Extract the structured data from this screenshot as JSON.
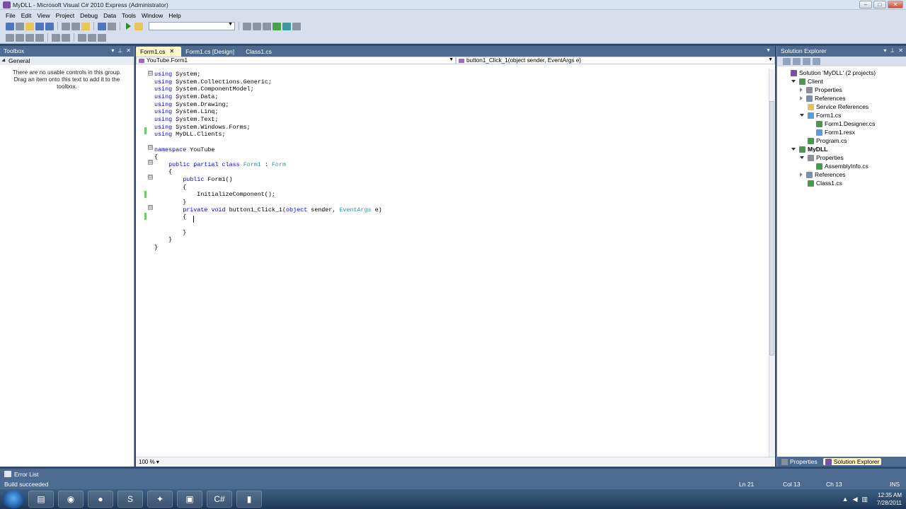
{
  "window": {
    "title": "MyDLL - Microsoft Visual C# 2010 Express (Administrator)",
    "controls": [
      "–",
      "□",
      "✕"
    ]
  },
  "menu": [
    "File",
    "Edit",
    "View",
    "Project",
    "Debug",
    "Data",
    "Tools",
    "Window",
    "Help"
  ],
  "toolbox": {
    "title": "Toolbox",
    "group": "General",
    "message": "There are no usable controls in this group. Drag an item onto this text to add it to the toolbox."
  },
  "tabs": [
    {
      "label": "Form1.cs",
      "active": true,
      "close": "✕"
    },
    {
      "label": "Form1.cs [Design]",
      "active": false
    },
    {
      "label": "Class1.cs",
      "active": false
    }
  ],
  "navbar": {
    "type_combo": "YouTube.Form1",
    "member_combo": "button1_Click_1(object sender, EventArgs e)"
  },
  "code": [
    [
      {
        "t": "using",
        "c": "kw"
      },
      {
        "t": " System;"
      }
    ],
    [
      {
        "t": "using",
        "c": "kw"
      },
      {
        "t": " System.Collections.Generic;"
      }
    ],
    [
      {
        "t": "using",
        "c": "kw"
      },
      {
        "t": " System.ComponentModel;"
      }
    ],
    [
      {
        "t": "using",
        "c": "kw"
      },
      {
        "t": " System.Data;"
      }
    ],
    [
      {
        "t": "using",
        "c": "kw"
      },
      {
        "t": " System.Drawing;"
      }
    ],
    [
      {
        "t": "using",
        "c": "kw"
      },
      {
        "t": " System.Linq;"
      }
    ],
    [
      {
        "t": "using",
        "c": "kw"
      },
      {
        "t": " System.Text;"
      }
    ],
    [
      {
        "t": "using",
        "c": "kw"
      },
      {
        "t": " System.Windows.Forms;"
      }
    ],
    [
      {
        "t": "using",
        "c": "kw"
      },
      {
        "t": " MyDLL.Clients;"
      }
    ],
    [],
    [
      {
        "t": "namespace",
        "c": "kw"
      },
      {
        "t": " YouTube"
      }
    ],
    [
      {
        "t": "{"
      }
    ],
    [
      {
        "t": "    "
      },
      {
        "t": "public",
        "c": "kw"
      },
      {
        "t": " "
      },
      {
        "t": "partial",
        "c": "kw"
      },
      {
        "t": " "
      },
      {
        "t": "class",
        "c": "kw"
      },
      {
        "t": " "
      },
      {
        "t": "Form1",
        "c": "ty"
      },
      {
        "t": " : "
      },
      {
        "t": "Form",
        "c": "ty"
      }
    ],
    [
      {
        "t": "    {"
      }
    ],
    [
      {
        "t": "        "
      },
      {
        "t": "public",
        "c": "kw"
      },
      {
        "t": " Form1()"
      }
    ],
    [
      {
        "t": "        {"
      }
    ],
    [
      {
        "t": "            InitializeComponent();"
      }
    ],
    [
      {
        "t": "        }"
      }
    ],
    [
      {
        "t": "        "
      },
      {
        "t": "private",
        "c": "kw"
      },
      {
        "t": " "
      },
      {
        "t": "void",
        "c": "kw"
      },
      {
        "t": " button1_Click_1("
      },
      {
        "t": "object",
        "c": "kw"
      },
      {
        "t": " sender, "
      },
      {
        "t": "EventArgs",
        "c": "ty"
      },
      {
        "t": " e)"
      }
    ],
    [
      {
        "t": "        {"
      }
    ],
    [
      {
        "t": "            "
      }
    ],
    [
      {
        "t": "        }"
      }
    ],
    [
      {
        "t": "    }"
      }
    ],
    [
      {
        "t": "}"
      }
    ]
  ],
  "fold_markers": [
    "⊟",
    "⊟",
    "⊟",
    "⊟",
    "⊟"
  ],
  "editor_footer": {
    "zoom": "100 %"
  },
  "solution_explorer": {
    "title": "Solution Explorer",
    "nodes": [
      {
        "label": "Solution 'MyDLL' (2 projects)",
        "icon": "solution-icon",
        "indent": 0,
        "expander": "none",
        "bold": false
      },
      {
        "label": "Client",
        "icon": "csharp-project-icon",
        "indent": 1,
        "expander": "open",
        "bold": false
      },
      {
        "label": "Properties",
        "icon": "properties-folder-icon",
        "indent": 2,
        "expander": "closed",
        "bold": false
      },
      {
        "label": "References",
        "icon": "references-icon",
        "indent": 2,
        "expander": "closed",
        "bold": false
      },
      {
        "label": "Service References",
        "icon": "folder-icon",
        "indent": 2,
        "expander": "none",
        "bold": false
      },
      {
        "label": "Form1.cs",
        "icon": "form-icon",
        "indent": 2,
        "expander": "open",
        "bold": false
      },
      {
        "label": "Form1.Designer.cs",
        "icon": "csharp-file-icon",
        "indent": 3,
        "expander": "none",
        "bold": false
      },
      {
        "label": "Form1.resx",
        "icon": "resx-file-icon",
        "indent": 3,
        "expander": "none",
        "bold": false
      },
      {
        "label": "Program.cs",
        "icon": "csharp-file-icon",
        "indent": 2,
        "expander": "none",
        "bold": false
      },
      {
        "label": "MyDLL",
        "icon": "csharp-project-icon",
        "indent": 1,
        "expander": "open",
        "bold": true
      },
      {
        "label": "Properties",
        "icon": "properties-folder-icon",
        "indent": 2,
        "expander": "open",
        "bold": false
      },
      {
        "label": "AssemblyInfo.cs",
        "icon": "csharp-file-icon",
        "indent": 3,
        "expander": "none",
        "bold": false
      },
      {
        "label": "References",
        "icon": "references-icon",
        "indent": 2,
        "expander": "closed",
        "bold": false
      },
      {
        "label": "Class1.cs",
        "icon": "csharp-file-icon",
        "indent": 2,
        "expander": "none",
        "bold": false
      }
    ],
    "bottom_tabs": [
      "Properties",
      "Solution Explorer"
    ]
  },
  "error_list": {
    "label": "Error List"
  },
  "status": {
    "message": "Build succeeded",
    "ln": "Ln 21",
    "col": "Col 13",
    "ch": "Ch 13",
    "mode": "INS"
  },
  "taskbar": {
    "time": "12:35 AM",
    "date": "7/28/2011"
  },
  "colors": {
    "keyword": "#0000ff",
    "type": "#2b91af",
    "chrome": "#4d6a91",
    "active_tab": "#fff6c9"
  }
}
